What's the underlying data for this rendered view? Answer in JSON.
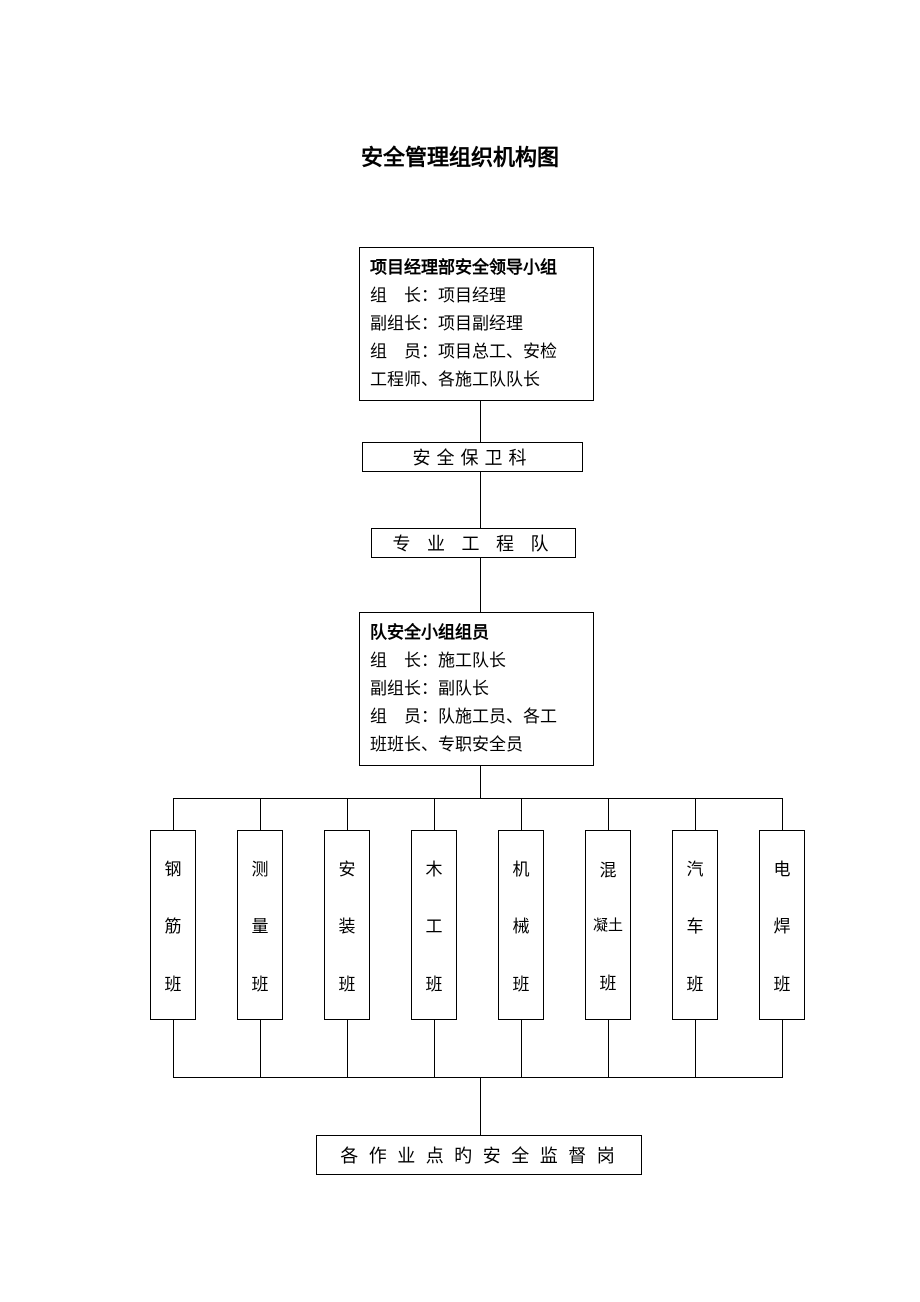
{
  "title": "安全管理组织机构图",
  "box1": {
    "heading": "项目经理部安全领导小组",
    "line1": "组　长：项目经理",
    "line2": "副组长：项目副经理",
    "line3": "组　员：项目总工、安检",
    "line4": "工程师、各施工队队长"
  },
  "box2": "安全保卫科",
  "box3": "专 业 工 程 队",
  "box4": {
    "heading": "队安全小组组员",
    "line1": "组　长：施工队长",
    "line2": "副组长：副队长",
    "line3": "组　员：队施工员、各工",
    "line4": "班班长、专职安全员"
  },
  "teams": [
    {
      "c1": "钢",
      "c2": "筋",
      "c3": "班"
    },
    {
      "c1": "测",
      "c2": "量",
      "c3": "班"
    },
    {
      "c1": "安",
      "c2": "装",
      "c3": "班"
    },
    {
      "c1": "木",
      "c2": "工",
      "c3": "班"
    },
    {
      "c1": "机",
      "c2": "械",
      "c3": "班"
    },
    {
      "c1": "混",
      "c2": "凝土",
      "c3": "班"
    },
    {
      "c1": "汽",
      "c2": "车",
      "c3": "班"
    },
    {
      "c1": "电",
      "c2": "焊",
      "c3": "班"
    }
  ],
  "box_bottom": "各 作 业 点 旳 安 全 监 督 岗"
}
